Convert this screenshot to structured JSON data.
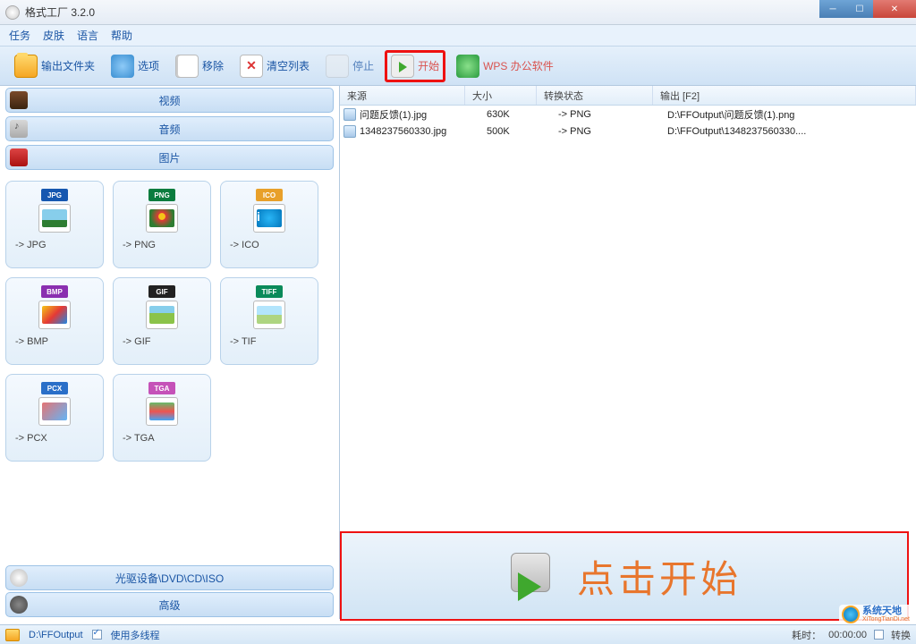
{
  "title": "格式工厂 3.2.0",
  "menu": {
    "task": "任务",
    "skin": "皮肤",
    "language": "语言",
    "help": "帮助"
  },
  "toolbar": {
    "output_folder": "输出文件夹",
    "options": "选项",
    "remove": "移除",
    "clear_list": "清空列表",
    "stop": "停止",
    "start": "开始",
    "wps": "WPS 办公软件"
  },
  "accordion": {
    "video": "视频",
    "audio": "音频",
    "image": "图片",
    "disc": "光驱设备\\DVD\\CD\\ISO",
    "advanced": "高级"
  },
  "formats": [
    {
      "badge": "JPG",
      "badgeClass": "jpg",
      "thumbClass": "ti-photo",
      "label": "-> JPG"
    },
    {
      "badge": "PNG",
      "badgeClass": "png",
      "thumbClass": "ti-flower",
      "label": "-> PNG"
    },
    {
      "badge": "ICO",
      "badgeClass": "ico",
      "thumbClass": "ti-info",
      "label": "-> ICO"
    },
    {
      "badge": "BMP",
      "badgeClass": "bmp",
      "thumbClass": "ti-brush",
      "label": "-> BMP"
    },
    {
      "badge": "GIF",
      "badgeClass": "gif",
      "thumbClass": "ti-gif",
      "label": "-> GIF"
    },
    {
      "badge": "TIFF",
      "badgeClass": "tif",
      "thumbClass": "ti-tif",
      "label": "-> TIF"
    },
    {
      "badge": "PCX",
      "badgeClass": "pcx",
      "thumbClass": "ti-pcx",
      "label": "-> PCX"
    },
    {
      "badge": "TGA",
      "badgeClass": "tga",
      "thumbClass": "ti-tga",
      "label": "-> TGA"
    }
  ],
  "columns": {
    "source": "来源",
    "size": "大小",
    "status": "转换状态",
    "output": "输出 [F2]"
  },
  "files": [
    {
      "name": "问题反馈(1).jpg",
      "size": "630K",
      "status": "-> PNG",
      "output": "D:\\FFOutput\\问题反馈(1).png"
    },
    {
      "name": "1348237560330.jpg",
      "size": "500K",
      "status": "-> PNG",
      "output": "D:\\FFOutput\\1348237560330...."
    }
  ],
  "banner": {
    "text": "点击开始"
  },
  "statusbar": {
    "path": "D:\\FFOutput",
    "multithread": "使用多线程",
    "elapsed_label": "耗时：",
    "elapsed": "00:00:00",
    "after": "转换"
  },
  "watermark": {
    "cn": "系统天地",
    "en": "XiTongTianDi.net"
  }
}
